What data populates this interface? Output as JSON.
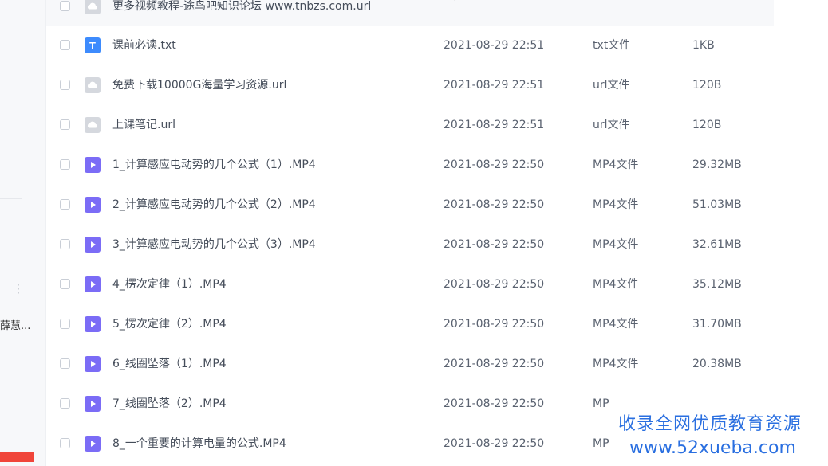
{
  "sidebar": {
    "user_label": "薛慧..."
  },
  "colors": {
    "accent": "#2a6fe0",
    "txt_icon": "#3d8bfd",
    "video_icon": "#7b6cf6",
    "link_icon": "#d5d8de",
    "danger": "#f0453a"
  },
  "files": [
    {
      "name": "更多视频教程-途鸟吧知识论坛 www.tnbzs.com.url",
      "date": "",
      "type": "",
      "size": "",
      "icon": "link-file-icon",
      "hover": true
    },
    {
      "name": "课前必读.txt",
      "date": "2021-08-29 22:51",
      "type": "txt文件",
      "size": "1KB",
      "icon": "txt-file-icon"
    },
    {
      "name": "免费下载10000G海量学习资源.url",
      "date": "2021-08-29 22:51",
      "type": "url文件",
      "size": "120B",
      "icon": "link-file-icon"
    },
    {
      "name": "上课笔记.url",
      "date": "2021-08-29 22:51",
      "type": "url文件",
      "size": "120B",
      "icon": "link-file-icon"
    },
    {
      "name": "1_计算感应电动势的几个公式（1）.MP4",
      "date": "2021-08-29 22:50",
      "type": "MP4文件",
      "size": "29.32MB",
      "icon": "video-file-icon"
    },
    {
      "name": "2_计算感应电动势的几个公式（2）.MP4",
      "date": "2021-08-29 22:50",
      "type": "MP4文件",
      "size": "51.03MB",
      "icon": "video-file-icon"
    },
    {
      "name": "3_计算感应电动势的几个公式（3）.MP4",
      "date": "2021-08-29 22:50",
      "type": "MP4文件",
      "size": "32.61MB",
      "icon": "video-file-icon"
    },
    {
      "name": "4_楞次定律（1）.MP4",
      "date": "2021-08-29 22:50",
      "type": "MP4文件",
      "size": "35.12MB",
      "icon": "video-file-icon"
    },
    {
      "name": "5_楞次定律（2）.MP4",
      "date": "2021-08-29 22:50",
      "type": "MP4文件",
      "size": "31.70MB",
      "icon": "video-file-icon"
    },
    {
      "name": "6_线圈坠落（1）.MP4",
      "date": "2021-08-29 22:50",
      "type": "MP4文件",
      "size": "20.38MB",
      "icon": "video-file-icon"
    },
    {
      "name": "7_线圈坠落（2）.MP4",
      "date": "2021-08-29 22:50",
      "type": "MP",
      "size": "",
      "icon": "video-file-icon"
    },
    {
      "name": "8_一个重要的计算电量的公式.MP4",
      "date": "2021-08-29 22:50",
      "type": "MP",
      "size": "",
      "icon": "video-file-icon"
    }
  ],
  "row_actions": [
    {
      "name": "share-icon"
    },
    {
      "name": "download-icon"
    },
    {
      "name": "delete-icon"
    },
    {
      "name": "rename-icon"
    }
  ],
  "watermark": {
    "line1": "收录全网优质教育资源",
    "line2": "www.52xueba.com"
  }
}
